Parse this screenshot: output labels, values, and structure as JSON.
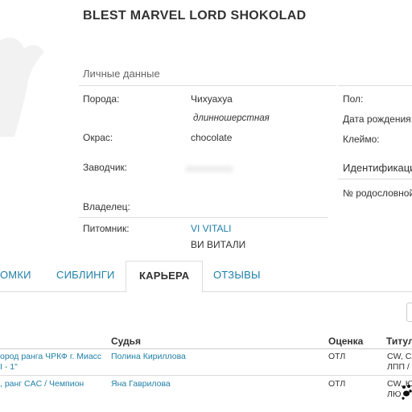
{
  "pet": {
    "name": "BLEST MARVEL LORD SHOKOLAD"
  },
  "personal": {
    "section_title": "Личные данные",
    "breed_label": "Порода:",
    "breed_value": "Чихуахуа",
    "breed_variety": "длинношерстная",
    "color_label": "Окрас:",
    "color_value": "chocolate",
    "breeder_label": "Заводчик:",
    "owner_label": "Владелец:",
    "kennel_label": "Питомник:",
    "kennel_value_latin": "VI VITALI",
    "kennel_value_cyr": "ВИ ВИТАЛИ",
    "sex_label": "Пол:",
    "dob_label": "Дата рождения:",
    "brand_label": "Клеймо:",
    "id_label": "Идентификаци",
    "pedigree_label": "№ родословной"
  },
  "tabs": [
    {
      "label": "ОМКИ"
    },
    {
      "label": "СИБЛИНГИ"
    },
    {
      "label": "КАРЬЕРА"
    },
    {
      "label": "ОТЗЫВЫ"
    }
  ],
  "career_table": {
    "headers": {
      "judge": "Судья",
      "grade": "Оценка",
      "title": "Титул"
    },
    "rows": [
      {
        "event_line1": "ород ранга ЧРКФ г. Миасс",
        "event_line2": "I - 1\"",
        "judge": "Полина Кириллова",
        "grade": "ОТЛ",
        "title_line1": "CW, CA",
        "title_line2": "ЛПП / Е"
      },
      {
        "event_line1": ", ранг CAC / Чемпион",
        "event_line2": "",
        "judge": "Яна Гаврилова",
        "grade": "ОТЛ",
        "title_line1": "CW, Ю",
        "title_line2": "ЛЮ"
      }
    ]
  },
  "icons": {
    "photo": "pet-photo-silhouette",
    "paw": "paw-icon"
  },
  "colors": {
    "link": "#1f7fa8",
    "text": "#333333",
    "border": "#dddddd"
  }
}
